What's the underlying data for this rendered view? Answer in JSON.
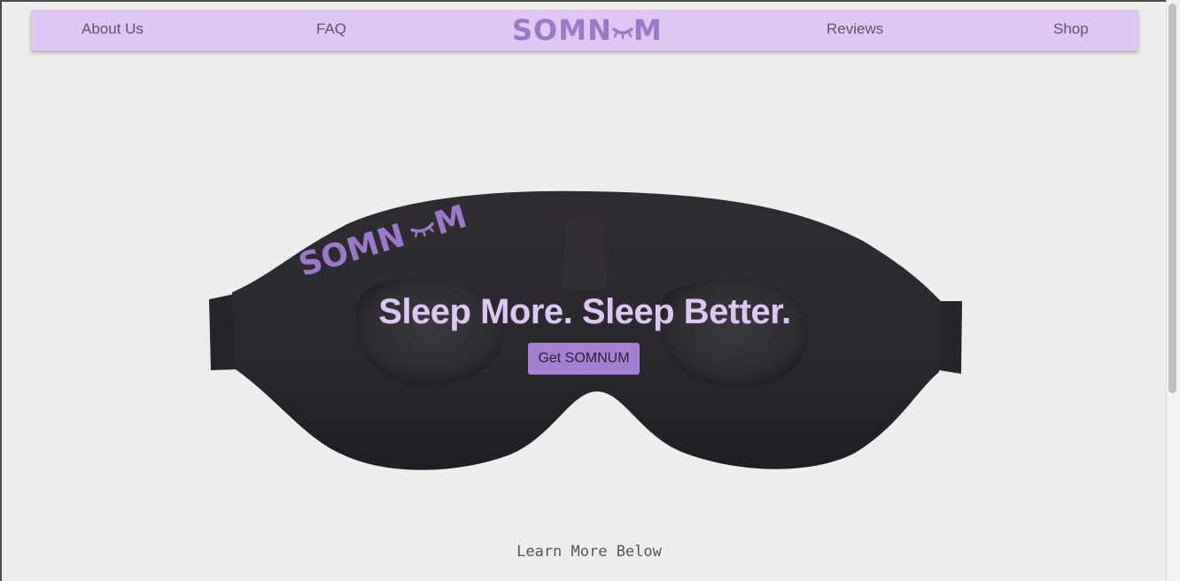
{
  "nav": {
    "about_label": "About Us",
    "faq_label": "FAQ",
    "logo_text_left": "SOMN",
    "logo_text_right": "M",
    "reviews_label": "Reviews",
    "shop_label": "Shop"
  },
  "hero": {
    "mask_brand_left": "SOMN",
    "mask_brand_right": "M",
    "title": "Sleep More. Sleep Better.",
    "cta_label": "Get SOMNUM"
  },
  "footer": {
    "learn_more_label": "Learn More Below"
  },
  "colors": {
    "nav_background": "#dfc6f4",
    "brand_purple": "#9c78c9",
    "cta_background": "#a580d2",
    "title_color": "#ddc6f3",
    "page_background": "#ededed"
  }
}
